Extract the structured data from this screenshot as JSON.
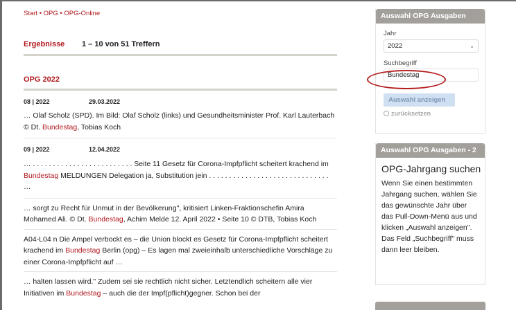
{
  "breadcrumb": {
    "text": "Start • OPG • OPG-Online"
  },
  "results": {
    "label": "Ergebnisse",
    "count": "1 – 10 von 51 Treffern"
  },
  "year_heading": "OPG 2022",
  "entries": [
    {
      "number": "08 | 2022",
      "date": "29.03.2022",
      "snippets": [
        {
          "parts": [
            "… Olaf Scholz (SPD). Im Bild: Olaf Scholz (links) und Gesundheitsminister Prof. Karl Lauterbach © Dt. ",
            "Bundestag",
            ", Tobias Koch"
          ]
        }
      ]
    },
    {
      "number": "09 | 2022",
      "date": "12.04.2022",
      "snippets": [
        {
          "parts": [
            "… . . . . . . . . . . . . . . . . . . . . . . . . . Seite 11 Gesetz für Corona-Impfpflicht scheitert krachend im ",
            "Bundestag",
            " MELDUNGEN Delegation ja, Substitution jein . . . . . . . . . . . . . . . . . . . . . . . . . . . . . . …"
          ]
        },
        {
          "parts": [
            "… sorgt zu Recht für Unmut in der Bevölkerung\", kritisiert Linken-Fraktionschefin Amira Mohamed Ali. © Dt. ",
            "Bundestag",
            ", Achim Melde 12. April 2022 • Seite 10 © DTB, Tobias Koch"
          ]
        },
        {
          "parts": [
            "A04-L04 n Die Ampel verbockt es – die Union blockt es Gesetz für Corona-Impfpflicht scheitert krachend im ",
            "Bundestag",
            " Berlin (opg) – Es lagen mal zweieinhalb unterschiedliche Vorschläge zu einer Corona-Impfpflicht auf …"
          ]
        },
        {
          "parts": [
            "… halten lassen wird.\" Zudem sei sie rechtlich nicht sicher. Letztendlich scheitern alle vier Initiativen im ",
            "Bundestag",
            " – auch die der Impf(pflicht)gegner. Schon bei der"
          ]
        }
      ]
    }
  ],
  "sidebar": {
    "box1": {
      "title": "Auswahl OPG Ausgaben",
      "year_label": "Jahr",
      "year_value": "2022",
      "search_label": "Suchbegriff",
      "search_value": "Bundestag",
      "submit_label": "Auswahl anzeigen",
      "reset_label": "zurücksetzen"
    },
    "box2": {
      "title": "Auswahl OPG Ausgaben - 2",
      "heading": "OPG-Jahrgang suchen",
      "text": "Wenn Sie einen bestimmten Jahrgang suchen, wählen Sie das gewünschte Jahr über das Pull-Down-Menü aus und klicken „Auswahl anzeigen\". Das Feld „Suchbegriff\" muss dann leer bleiben."
    }
  },
  "colors": {
    "accent": "#b1191e",
    "box_header": "#a3a09b",
    "button_bg": "#cfe0f3"
  },
  "icons": {
    "select": "chevron-down-icon",
    "reset": "reset-circle-icon"
  }
}
